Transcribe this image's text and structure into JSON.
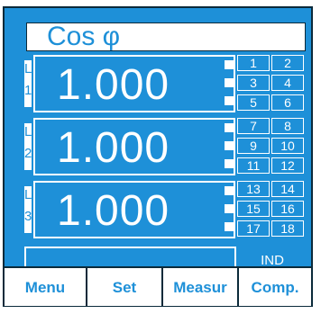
{
  "header": {
    "title": "Cos φ"
  },
  "phases": [
    {
      "letter": "L",
      "number": "1",
      "value": "1.000",
      "cells": [
        "1",
        "2",
        "3",
        "4",
        "5",
        "6"
      ]
    },
    {
      "letter": "L",
      "number": "2",
      "value": "1.000",
      "cells": [
        "7",
        "8",
        "9",
        "10",
        "11",
        "12"
      ]
    },
    {
      "letter": "L",
      "number": "3",
      "value": "1.000",
      "cells": [
        "13",
        "14",
        "15",
        "16",
        "17",
        "18"
      ]
    }
  ],
  "status": {
    "mode": "IND"
  },
  "menu": {
    "menu": "Menu",
    "set": "Set",
    "measur": "Measur",
    "comp": "Comp."
  },
  "colors": {
    "lcd_blue": "#1e90d8",
    "frame_dark": "#0b2a3a",
    "white": "#ffffff"
  }
}
